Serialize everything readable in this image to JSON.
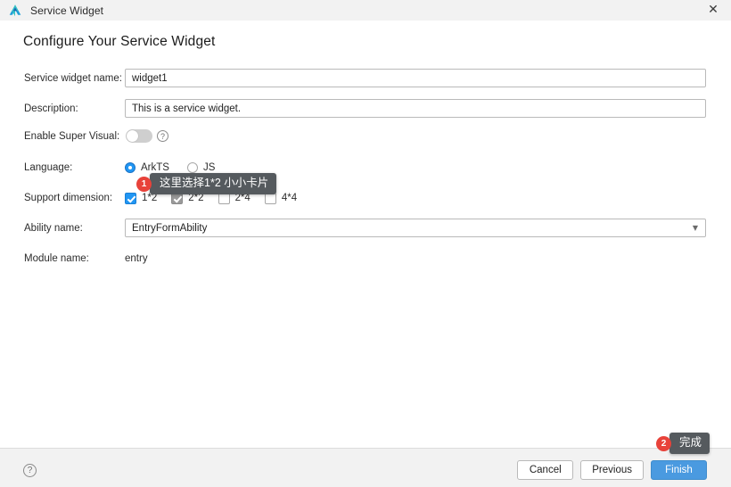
{
  "window": {
    "title": "Service Widget",
    "app_icon": "harmonyos-delta-icon",
    "close_icon": "close-icon"
  },
  "dialog": {
    "heading": "Configure Your Service Widget",
    "fields": {
      "widget_name": {
        "label": "Service widget name:",
        "value": "widget1",
        "placeholder": "Service widget name"
      },
      "description": {
        "label": "Description:",
        "value": "This is a service widget.",
        "placeholder": "Description"
      },
      "super_visual": {
        "label": "Enable Super Visual:",
        "toggle_state": "off",
        "help_icon": "question-mark-icon"
      },
      "language": {
        "label": "Language:",
        "options": [
          {
            "label": "ArkTS",
            "selected": true
          },
          {
            "label": "JS",
            "selected": false
          }
        ]
      },
      "support_dimension": {
        "label": "Support dimension:",
        "options": [
          {
            "label": "1*2",
            "checked": true,
            "disabled": false
          },
          {
            "label": "2*2",
            "checked": true,
            "disabled": true
          },
          {
            "label": "2*4",
            "checked": false,
            "disabled": false
          },
          {
            "label": "4*4",
            "checked": false,
            "disabled": false
          }
        ]
      },
      "ability_name": {
        "label": "Ability name:",
        "value": "EntryFormAbility",
        "arrow_icon": "chevron-down-icon"
      },
      "module_name": {
        "label": "Module name:",
        "value": "entry"
      }
    }
  },
  "footer": {
    "help_icon": "question-mark-icon",
    "buttons": {
      "cancel": "Cancel",
      "previous": "Previous",
      "finish": "Finish"
    }
  },
  "annotations": [
    {
      "badge": "1",
      "text": "这里选择1*2 小小卡片"
    },
    {
      "badge": "2",
      "text": "完成"
    }
  ],
  "colors": {
    "accent": "#2196f3",
    "primary_button": "#4a9ae0",
    "badge": "#e8423a",
    "tooltip_bg": "#555a5e",
    "chrome_bg": "#f2f2f2"
  }
}
